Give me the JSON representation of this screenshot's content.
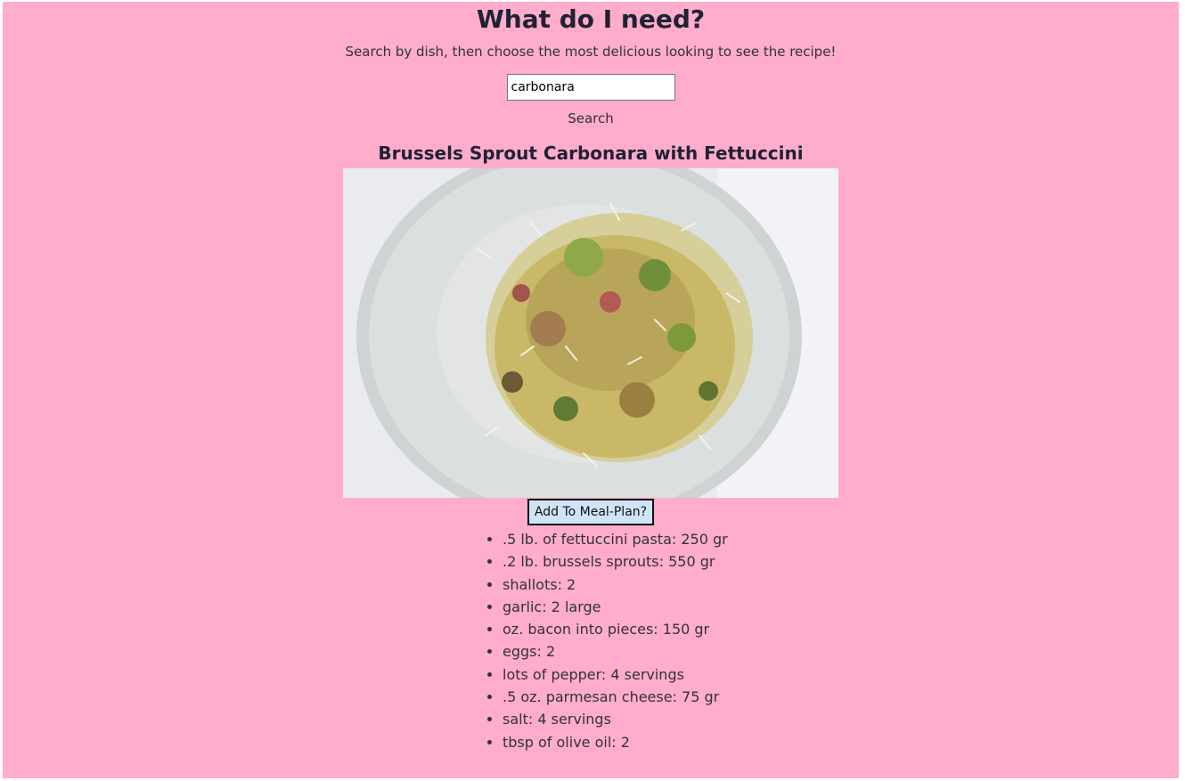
{
  "page": {
    "title": "What do I need?",
    "subtitle": "Search by dish, then choose the most delicious looking to see the recipe!"
  },
  "search": {
    "value": "carbonara",
    "button_label": "Search"
  },
  "recipe": {
    "title": "Brussels Sprout Carbonara with Fettuccini",
    "add_button_label": "Add To Meal-Plan?",
    "ingredients": [
      ".5 lb. of fettuccini pasta: 250 gr",
      ".2 lb. brussels sprouts: 550 gr",
      "shallots: 2",
      "garlic: 2 large",
      "oz. bacon into pieces: 150 gr",
      "eggs: 2",
      "lots of pepper: 4 servings",
      ".5 oz. parmesan cheese: 75 gr",
      "salt: 4 servings",
      "tbsp of olive oil: 2"
    ]
  },
  "colors": {
    "background": "#ffaccd",
    "button_bg": "#cfe4f7"
  }
}
